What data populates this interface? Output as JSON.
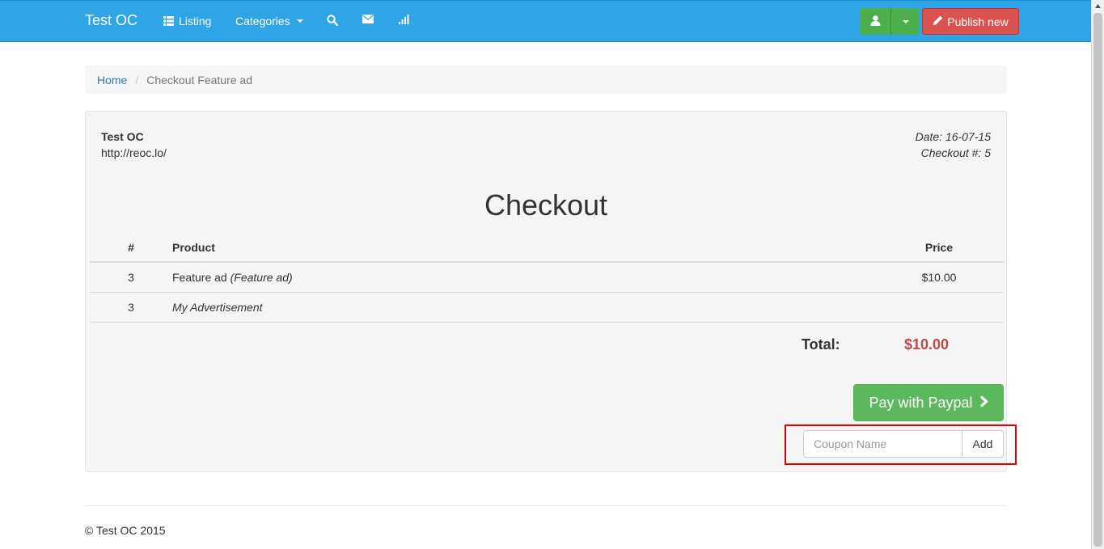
{
  "navbar": {
    "brand": "Test OC",
    "items": [
      {
        "label": "Listing",
        "icon": "list-icon"
      },
      {
        "label": "Categories",
        "icon": "caret-down-icon"
      },
      {
        "label": "",
        "icon": "search-icon"
      },
      {
        "label": "",
        "icon": "envelope-icon"
      },
      {
        "label": "",
        "icon": "signal-icon"
      }
    ],
    "user_icon": "user-icon",
    "publish_label": "Publish new",
    "publish_icon": "pencil-icon"
  },
  "breadcrumb": {
    "home": "Home",
    "current": "Checkout Feature ad"
  },
  "invoice": {
    "company_name": "Test OC",
    "company_url": "http://reoc.lo/",
    "date": "Date: 16-07-15",
    "checkout_no": "Checkout #: 5",
    "title": "Checkout",
    "columns": {
      "num": "#",
      "product": "Product",
      "price": "Price"
    },
    "rows": [
      {
        "num": "3",
        "product": "Feature ad",
        "product_note": "(Feature ad)",
        "price": "$10.00"
      },
      {
        "num": "3",
        "product": "",
        "product_note": "My Advertisement",
        "price": ""
      }
    ],
    "total_label": "Total:",
    "total_value": "$10.00",
    "pay_label": "Pay with Paypal",
    "coupon_placeholder": "Coupon Name",
    "coupon_add": "Add"
  },
  "footer": {
    "copyright": "© Test OC 2015"
  },
  "colors": {
    "navbar": "#2fa4e7",
    "success": "#5cb85c",
    "danger": "#d9534f",
    "total": "#b94a48",
    "highlight": "#e00000"
  }
}
